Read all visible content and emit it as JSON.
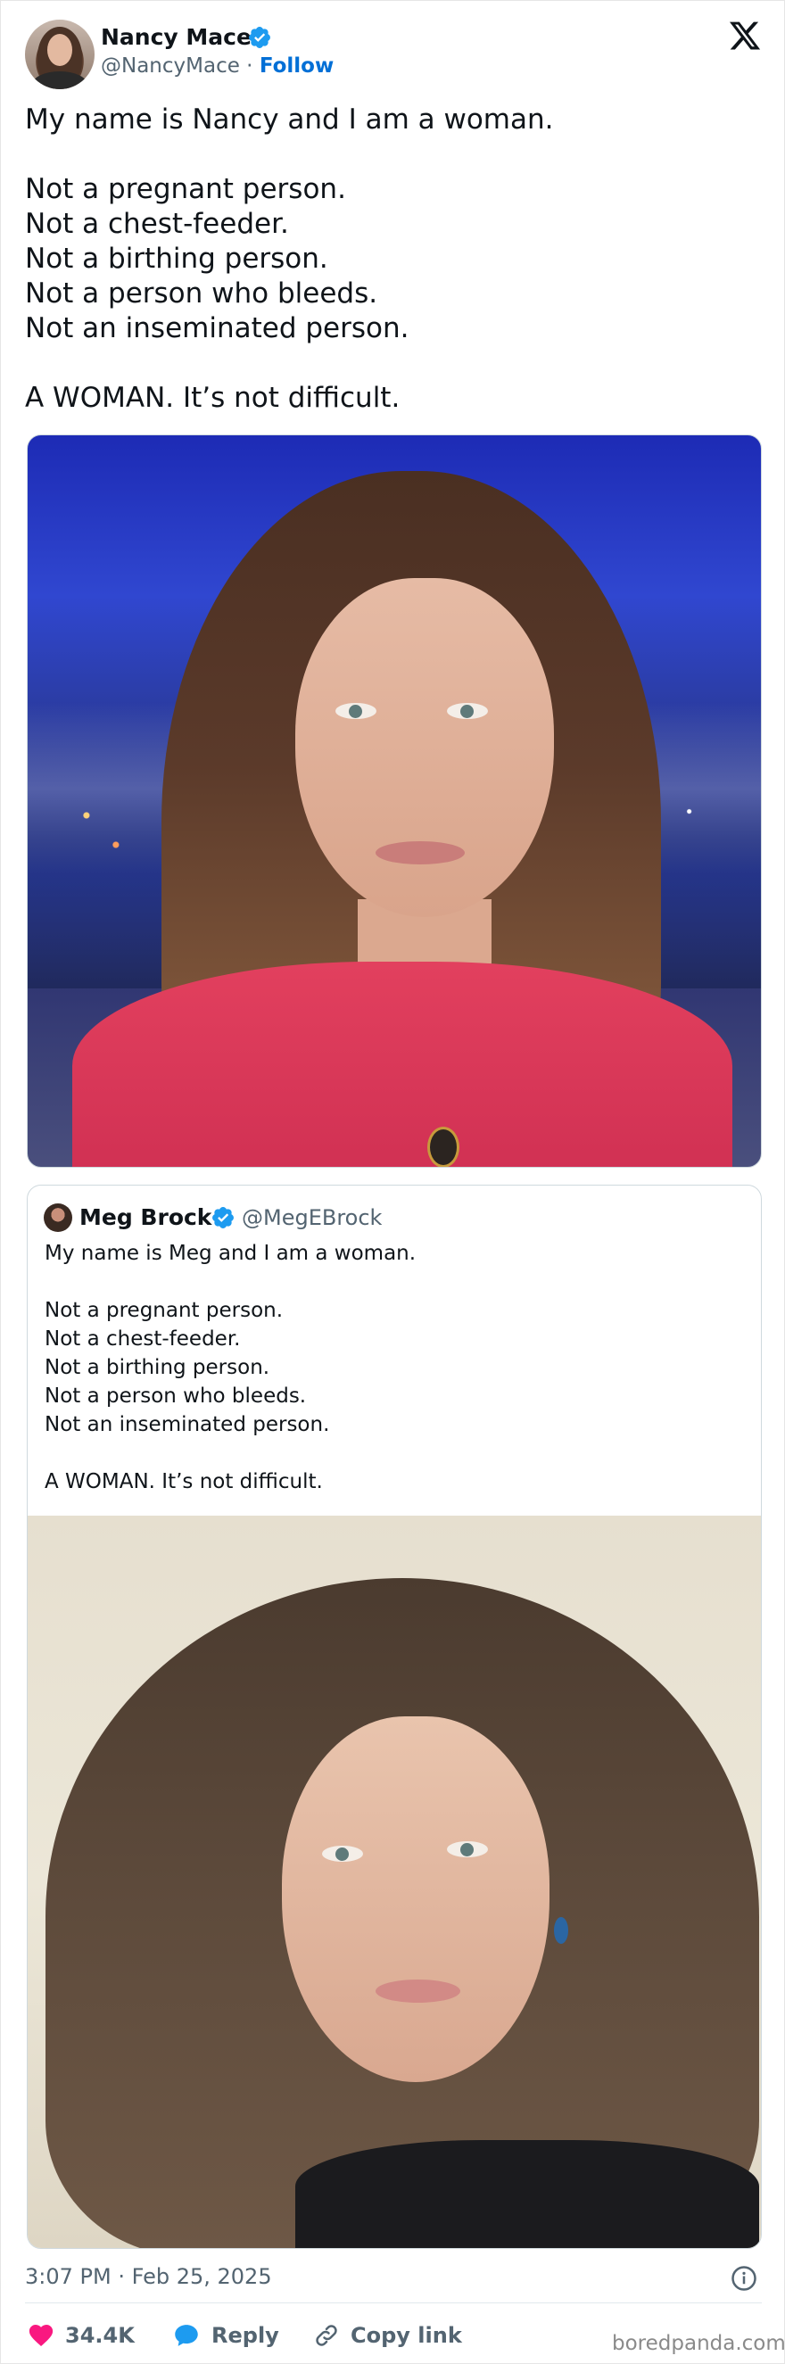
{
  "author": {
    "name": "Nancy Mace",
    "handle": "@NancyMace",
    "separator": " · ",
    "follow_label": "Follow",
    "verified_icon": "verified-badge-icon"
  },
  "tweet_text": "My name is Nancy and I am a woman.\n\nNot a pregnant person.\nNot a chest-feeder.\nNot a birthing person.\nNot a person who bleeds.\nNot an inseminated person.\n\nA WOMAN.  It’s not difficult.",
  "quoted": {
    "name": "Meg Brock",
    "handle": "@MegEBrock",
    "text": "My name is Meg and I am a woman.\n\nNot a pregnant person.\nNot a chest-feeder.\nNot a birthing person.\nNot a person who bleeds.\nNot an inseminated person.\n\nA WOMAN.  It’s not difficult."
  },
  "footer": {
    "timestamp": "3:07 PM · Feb 25, 2025",
    "likes": "34.4K",
    "reply_label": "Reply",
    "copy_link_label": "Copy link"
  },
  "watermark": "boredpanda.com",
  "colors": {
    "verified": "#1d9bf0",
    "follow": "#006fd6",
    "like": "#f91880",
    "reply": "#1d9bf0",
    "secondary_text": "#536471"
  }
}
